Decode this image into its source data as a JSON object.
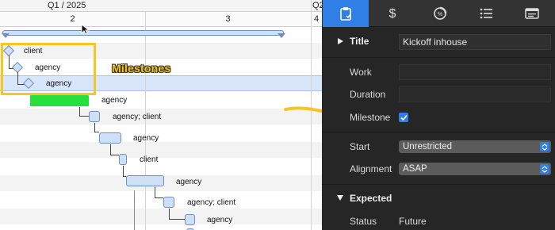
{
  "gantt": {
    "quarter_labels": [
      "Q1 / 2025",
      "Q2",
      "4"
    ],
    "column_labels": [
      "2",
      "3"
    ],
    "rows": [
      {
        "label": "client"
      },
      {
        "label": "agency"
      },
      {
        "label": "agency"
      },
      {
        "label": "agency"
      },
      {
        "label": "agency; client"
      },
      {
        "label": "agency"
      },
      {
        "label": "client"
      },
      {
        "label": "agency"
      },
      {
        "label": "agency; client"
      },
      {
        "label": "agency"
      }
    ],
    "callout_text": "Milestones",
    "colors": {
      "milestone_bar": "#27e03e",
      "callout": "#f7c623",
      "selection": "#d8e6fb"
    }
  },
  "inspector": {
    "tabs": [
      {
        "icon": "clipboard-icon"
      },
      {
        "icon": "dollar-icon"
      },
      {
        "icon": "progress-icon"
      },
      {
        "icon": "list-icon"
      },
      {
        "icon": "note-icon"
      }
    ],
    "title_section": "Title",
    "title_value": "Kickoff inhouse",
    "work_label": "Work",
    "work_value": "",
    "duration_label": "Duration",
    "duration_value": "",
    "milestone_label": "Milestone",
    "milestone_checked": true,
    "start_label": "Start",
    "start_value": "Unrestricted",
    "alignment_label": "Alignment",
    "alignment_value": "ASAP",
    "expected_section": "Expected",
    "status_label": "Status",
    "status_value": "Future",
    "accent": "#2f7fe6"
  }
}
